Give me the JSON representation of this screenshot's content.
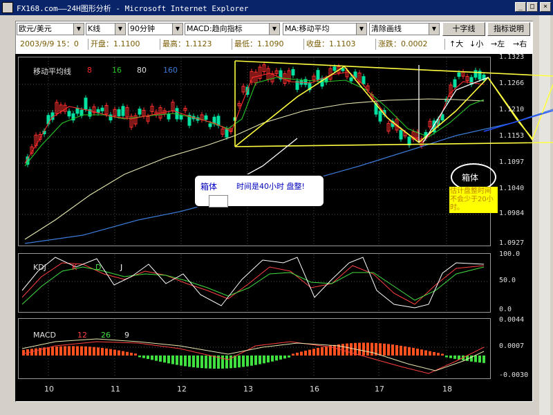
{
  "window": {
    "title": "FX168.com——24H图形分析 - Microsoft Internet Explorer",
    "controls": [
      "_",
      "□",
      "×"
    ]
  },
  "toolbar": {
    "pair": "欧元/美元",
    "chart_type": "K线",
    "period": "90分钟",
    "indicator": "MACD:趋向指标",
    "overlay": "MA:移动平均",
    "clear": "清除画线",
    "crosshair_button": "十字线",
    "help_button": "指标说明"
  },
  "quote": {
    "datetime": "2003/9/9 15：0",
    "open": "开盘：1.1100",
    "high": "最高：1.1123",
    "low": "最低：1.1090",
    "close": "收盘：1.1103",
    "change": "涨跌：0.0002"
  },
  "zoom": {
    "up": "↑大",
    "down": "↓小",
    "left": "→左",
    "right": "→右"
  },
  "ma_legend": {
    "title": "移动平均线",
    "ma8": "8",
    "ma16": "16",
    "ma80": "80",
    "ma160": "160"
  },
  "kdj_legend": {
    "title": "KDJ",
    "k": "K",
    "d": "D",
    "j": "J"
  },
  "macd_legend": {
    "title": "MACD",
    "a": "12",
    "b": "26",
    "c": "9"
  },
  "price_axis": [
    "1.1323",
    "1.1266",
    "1.1210",
    "1.1153",
    "1.1097",
    "1.1040",
    "1.0984",
    "1.0927"
  ],
  "kdj_axis": [
    "100.0",
    "50.0",
    "0.0"
  ],
  "macd_axis": [
    "0.0044",
    "0.0007",
    "-0.0030"
  ],
  "date_axis": [
    "10",
    "11",
    "12",
    "13",
    "16",
    "17",
    "18"
  ],
  "annotations": {
    "box1_label": "箱体",
    "box1_note": "时间是40小时 盘整!",
    "box2_label": "箱体",
    "box2_note": "估计盘整时间不会少于20小时。"
  },
  "colors": {
    "up": "#ff3030",
    "down": "#00e0a0",
    "ma8": "#ff2a2a",
    "ma16": "#27c827",
    "ma80": "#e0e0a0",
    "ma160": "#3a7ad8",
    "box": "#ffff40"
  }
}
